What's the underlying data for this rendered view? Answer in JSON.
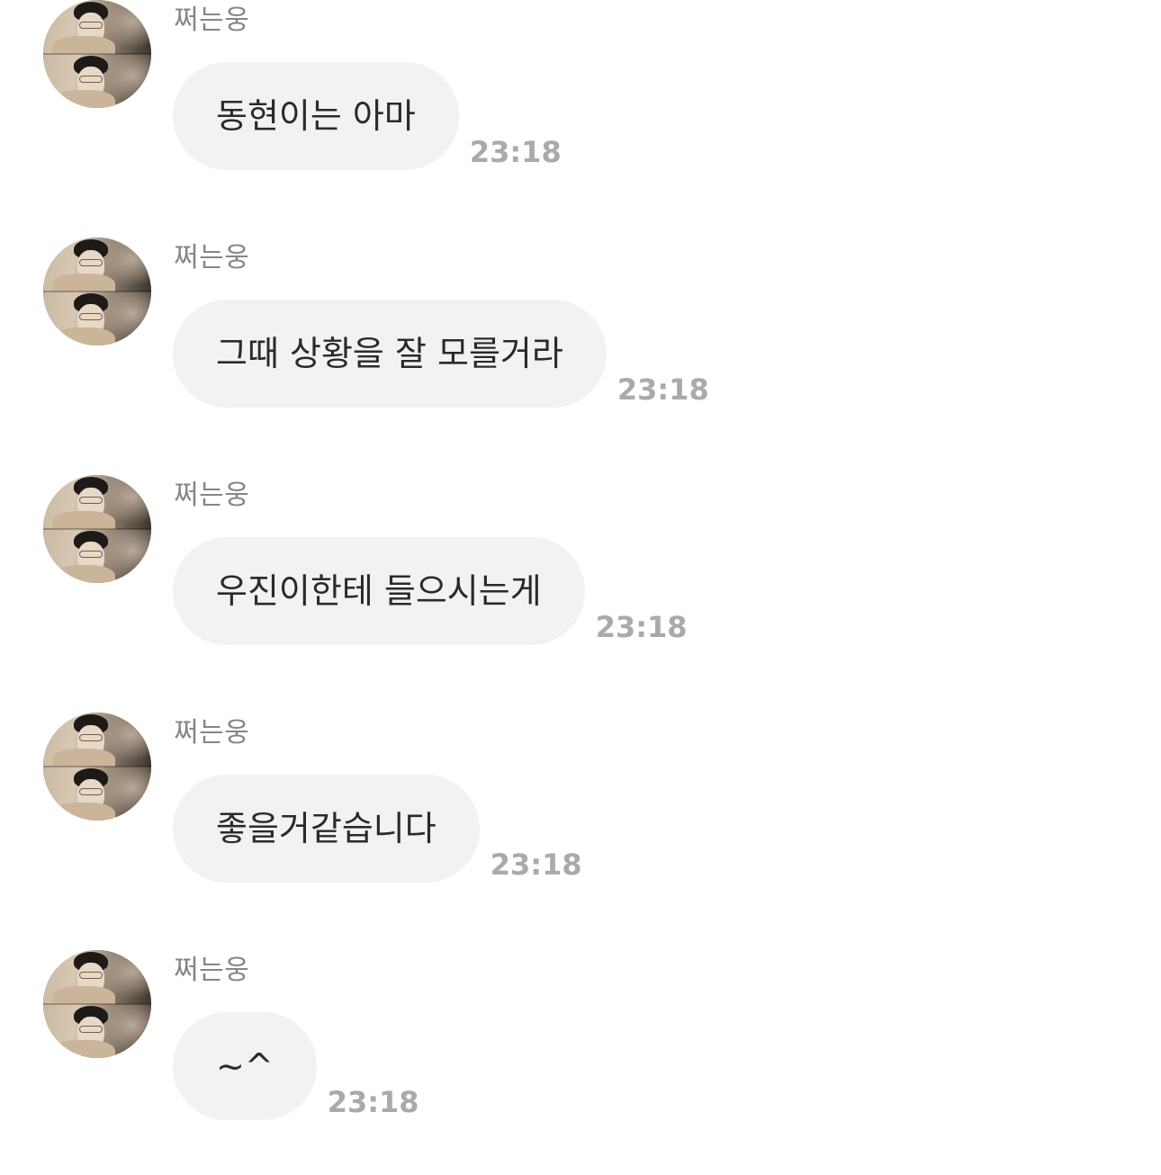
{
  "messages": [
    {
      "sender": "쩌는웅",
      "text": "동현이는 아마",
      "time": "23:18"
    },
    {
      "sender": "쩌는웅",
      "text": "그때 상황을 잘 모를거라",
      "time": "23:18"
    },
    {
      "sender": "쩌는웅",
      "text": "우진이한테 들으시는게",
      "time": "23:18"
    },
    {
      "sender": "쩌는웅",
      "text": "좋을거같습니다",
      "time": "23:18"
    },
    {
      "sender": "쩌는웅",
      "text": "~^",
      "time": "23:18"
    }
  ],
  "colors": {
    "bubble_background": "#f2f2f5",
    "message_text": "#2a2a2d",
    "sender_text": "#85858a",
    "timestamp_text": "#a9a9ae"
  }
}
